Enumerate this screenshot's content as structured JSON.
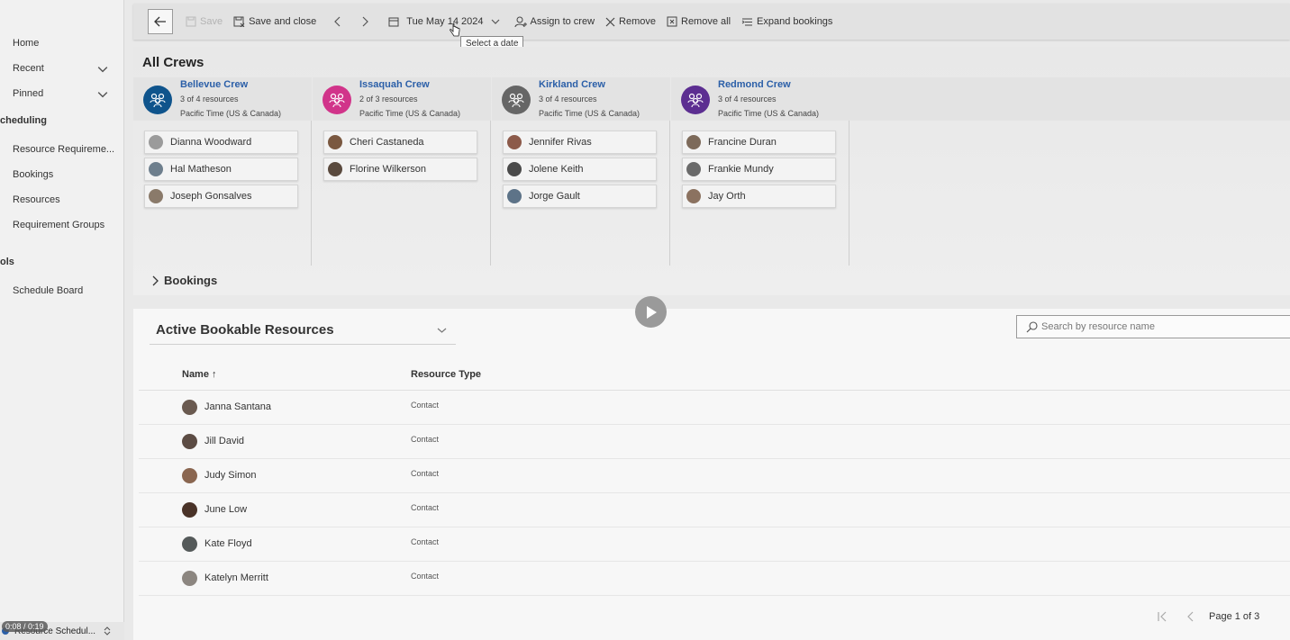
{
  "sidebar": {
    "items": [
      {
        "label": "Home"
      },
      {
        "label": "Recent"
      },
      {
        "label": "Pinned"
      }
    ],
    "section_scheduling": "cheduling",
    "scheduling_items": [
      {
        "label": "Resource Requireme..."
      },
      {
        "label": "Bookings"
      },
      {
        "label": "Resources"
      },
      {
        "label": "Requirement Groups"
      }
    ],
    "section_tools": "ols",
    "tools_items": [
      {
        "label": "Schedule Board"
      }
    ],
    "bottom_label": "Resource Schedul..."
  },
  "toolbar": {
    "save": "Save",
    "save_close": "Save and close",
    "date": "Tue May 14 2024",
    "assign": "Assign to crew",
    "remove": "Remove",
    "remove_all": "Remove all",
    "expand": "Expand bookings",
    "tooltip": "Select a date"
  },
  "crews": {
    "title": "All Crews",
    "bookings_label": "Bookings",
    "list": [
      {
        "name": "Bellevue Crew",
        "count": "3 of 4 resources",
        "tz": "Pacific Time (US & Canada)",
        "color": "#0f548c",
        "members": [
          "Dianna Woodward",
          "Hal Matheson",
          "Joseph Gonsalves"
        ]
      },
      {
        "name": "Issaquah Crew",
        "count": "2 of 3 resources",
        "tz": "Pacific Time (US & Canada)",
        "color": "#d1348a",
        "members": [
          "Cheri Castaneda",
          "Florine Wilkerson"
        ]
      },
      {
        "name": "Kirkland Crew",
        "count": "3 of 4 resources",
        "tz": "Pacific Time (US & Canada)",
        "color": "#666666",
        "members": [
          "Jennifer Rivas",
          "Jolene Keith",
          "Jorge Gault"
        ]
      },
      {
        "name": "Redmond Crew",
        "count": "3 of 4 resources",
        "tz": "Pacific Time (US & Canada)",
        "color": "#5c2e91",
        "members": [
          "Francine Duran",
          "Frankie Mundy",
          "Jay Orth"
        ]
      }
    ]
  },
  "resources": {
    "view_title": "Active Bookable Resources",
    "search_placeholder": "Search by resource name",
    "columns": {
      "name": "Name ↑",
      "type": "Resource Type"
    },
    "rows": [
      {
        "name": "Janna Santana",
        "type": "Contact"
      },
      {
        "name": "Jill David",
        "type": "Contact"
      },
      {
        "name": "Judy Simon",
        "type": "Contact"
      },
      {
        "name": "June Low",
        "type": "Contact"
      },
      {
        "name": "Kate Floyd",
        "type": "Contact"
      },
      {
        "name": "Katelyn Merritt",
        "type": "Contact"
      }
    ],
    "page_label": "Page 1 of 3"
  },
  "video": {
    "time": "0:08 / 0:19"
  }
}
